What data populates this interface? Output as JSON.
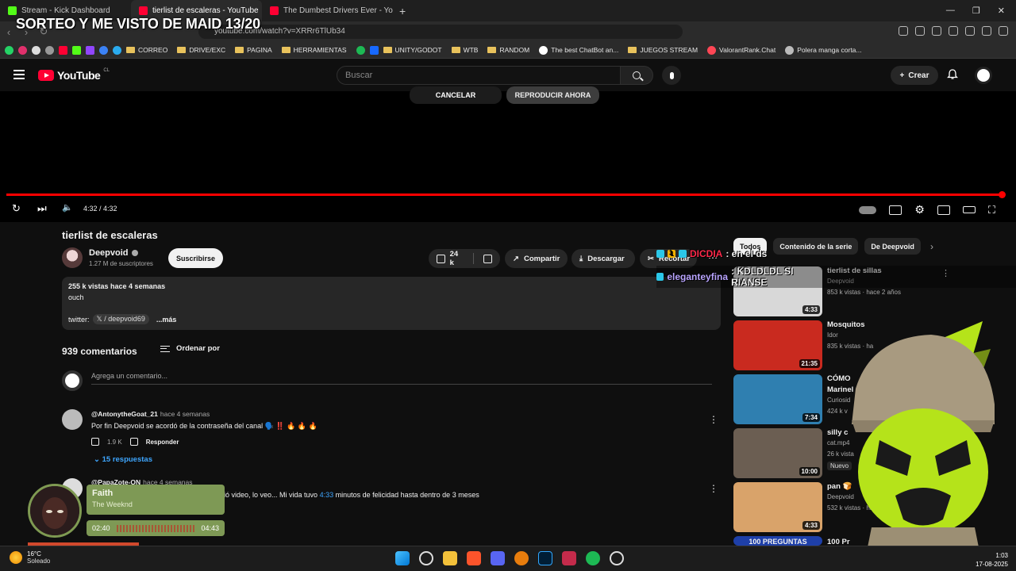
{
  "browser": {
    "tabs": [
      {
        "title": "Stream - Kick Dashboard",
        "color": "#53fc18"
      },
      {
        "title": "tierlist de escaleras - YouTube",
        "color": "#ff0033"
      },
      {
        "title": "The Dumbest Drivers Ever - YouTube",
        "color": "#ff0033"
      }
    ],
    "url": "youtube.com/watch?v=XRRr6TlUb34",
    "bookmarks": [
      "CORREO",
      "DRIVE/EXC",
      "PAGINA",
      "HERRAMIENTAS",
      "UNITY/GODOT",
      "WTB",
      "RANDOM",
      "The best ChatBot an...",
      "JUEGOS STREAM",
      "ValorantRank.Chat",
      "Polera manga corta..."
    ]
  },
  "stream_title": "SORTEO Y ME VISTO DE MAID 13/20",
  "youtube": {
    "logo_text": "YouTube",
    "logo_region": "CL",
    "search_placeholder": "Buscar",
    "create_label": "Crear"
  },
  "player": {
    "cancel_label": "CANCELAR",
    "play_now_label": "REPRODUCIR AHORA",
    "time": "4:32 / 4:32",
    "progress": 1.0
  },
  "video": {
    "title": "tierlist de escaleras",
    "channel": "Deepvoid",
    "subscribers": "1.27 M de suscriptores",
    "subscribe_label": "Suscribirse",
    "likes": "24 k",
    "share_label": "Compartir",
    "download_label": "Descargar",
    "clip_label": "Recortar",
    "views_date": "255 k vistas  hace 4 semanas",
    "desc_line": "ouch",
    "twitter_label": "twitter:",
    "twitter_handle": "/ deepvoid69",
    "more_label": "...más"
  },
  "comments": {
    "count": "939 comentarios",
    "sort_label": "Ordenar por",
    "add_placeholder": "Agrega un comentario...",
    "items": [
      {
        "author": "@AntonytheGoat_21",
        "time": "hace 4 semanas",
        "text": "Por fin Deepvoid se acordó de la contraseña del canal 🗣️ ‼️ 🔥 🔥 🔥",
        "likes": "1.9 K",
        "reply_label": "Responder",
        "replies": "15 respuestas"
      },
      {
        "author": "@PapaZote-ON",
        "time": "hace 4 semanas",
        "text_before": "ió video, lo veo... Mi vida tuvo ",
        "text_link": "4:33",
        "text_after": " minutos de felicidad hasta dentro de 3 meses"
      }
    ]
  },
  "sidebar": {
    "chips": [
      "Todos",
      "Contenido de la serie",
      "De Deepvoid"
    ],
    "items": [
      {
        "title": "tierlist de sillas",
        "channel": "Deepvoid",
        "views": "853 k vistas · hace 2 años",
        "duration": "4:33",
        "bg": "#d8d8d8"
      },
      {
        "title": "Mosquitos",
        "channel": "Idor",
        "views": "835 k vistas · ha",
        "duration": "21:35",
        "bg": "#c92a1f"
      },
      {
        "title": "CÓMO",
        "title2": "Marinel",
        "channel": "Curiosid",
        "views": "424 k v",
        "duration": "7:34",
        "bg": "#2f7fb0"
      },
      {
        "title": "silly c",
        "channel": "cat.mp4",
        "views": "26 k vista",
        "duration": "10:00",
        "badge": "Nuevo",
        "bg": "#6b5e52"
      },
      {
        "title": "pan 🍞",
        "channel": "Deepvoid",
        "views": "532 k vistas · hac",
        "duration": "4:33",
        "bg": "#d9a36a"
      },
      {
        "title": "100 Pr",
        "thumb_text": "100 PREGUNTAS",
        "bg": "#1e3fa8"
      }
    ]
  },
  "overlay": {
    "chat": [
      {
        "user": "DICDIA",
        "message": ": en el ds",
        "color": "#ff2a4b"
      },
      {
        "user": "eleganteyfina",
        "message": ": KDLDLDL SI RIANSE",
        "color": "#b9a4ff"
      }
    ],
    "music": {
      "title": "Faith",
      "artist": "The Weeknd",
      "elapsed": "02:40",
      "total": "04:43"
    }
  },
  "taskbar": {
    "temp": "16°C",
    "weather": "Soleado",
    "time": "1:03",
    "date": "17-08-2025"
  }
}
